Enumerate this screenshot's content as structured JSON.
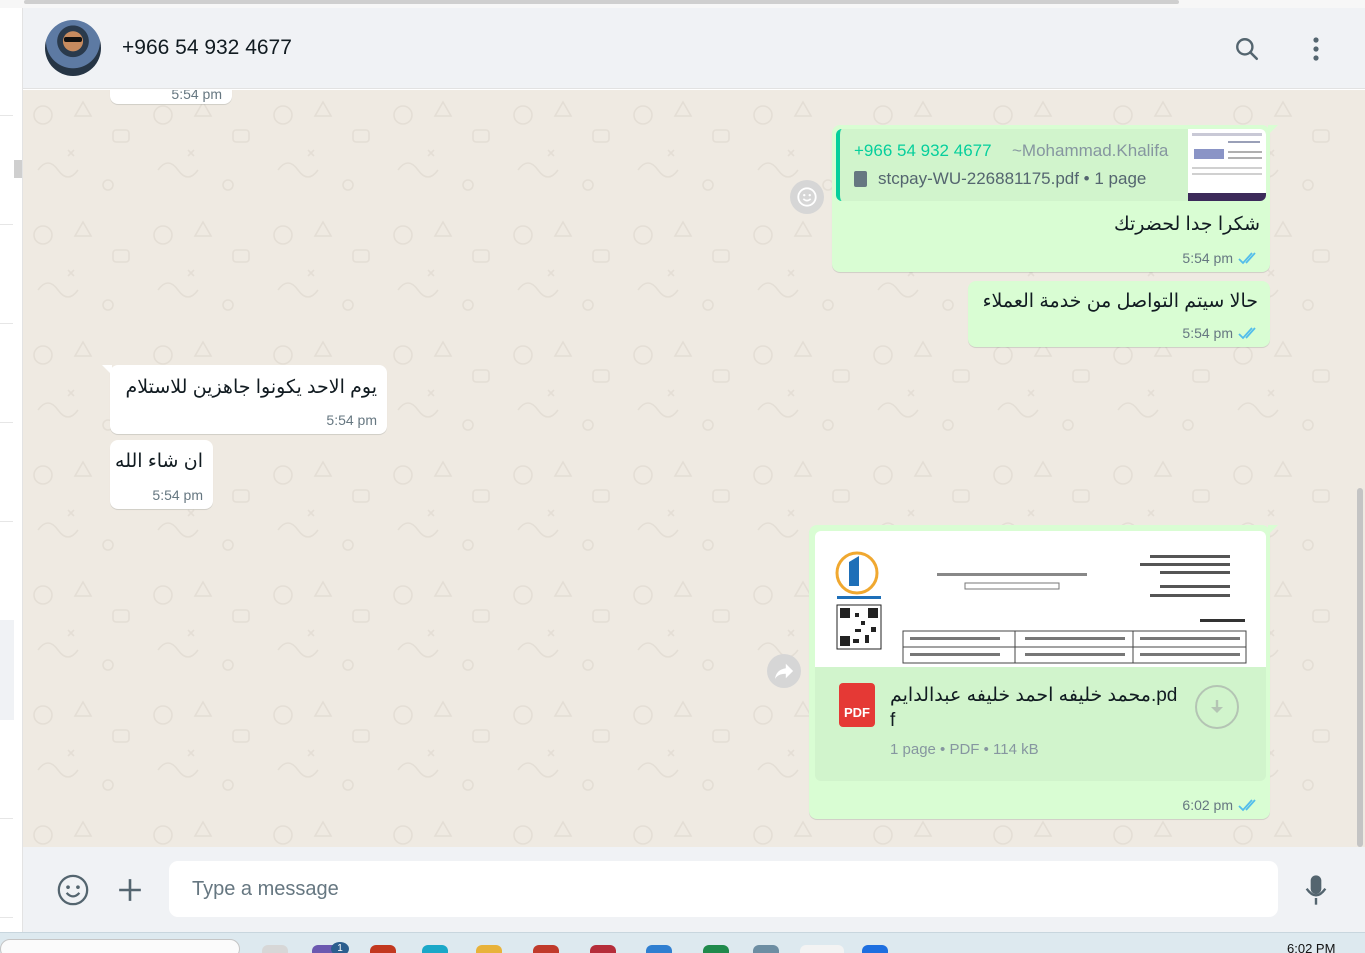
{
  "header": {
    "contact_name": "+966 54 932 4677"
  },
  "messages": {
    "top_partial_time": "5:54 pm",
    "reply": {
      "quote_number": "+966 54 932 4677",
      "quote_alias": "~Mohammad.Khalifa",
      "quote_file": "stcpay-WU-226881175.pdf • 1 page",
      "text": "شكرا جدا لحضرتك",
      "time": "5:54 pm"
    },
    "out2": {
      "text": "حالا سيتم التواصل من خدمة العملاء",
      "time": "5:54 pm"
    },
    "in1": {
      "text": "يوم الاحد يكونوا جاهزين للاستلام",
      "time": "5:54 pm"
    },
    "in2": {
      "text": "ان شاء الله",
      "time": "5:54 pm"
    },
    "doc": {
      "icon_label": "PDF",
      "name_line1": "محمد خليفه احمد خليفه عبدالدايم.pd",
      "name_line2": "f",
      "info": "1 page • PDF • 114 kB",
      "time": "6:02 pm"
    }
  },
  "composer": {
    "placeholder": "Type a message"
  },
  "taskbar": {
    "clock": "6:02 PM",
    "badge": "1"
  },
  "colors": {
    "outgoing_bubble": "#d9fdd3",
    "incoming_bubble": "#ffffff",
    "chat_background": "#efeae2",
    "header_background": "#f0f2f5",
    "read_ticks": "#53bdeb",
    "quote_accent": "#06cf9c",
    "pdf_red": "#e53935"
  },
  "icons": {
    "header": [
      "search-icon",
      "menu-icon"
    ],
    "composer": [
      "emoji-icon",
      "attach-plus-icon",
      "microphone-icon"
    ],
    "chat": [
      "react-emoji-icon",
      "forward-icon",
      "download-icon",
      "double-check-icon",
      "document-icon"
    ]
  }
}
